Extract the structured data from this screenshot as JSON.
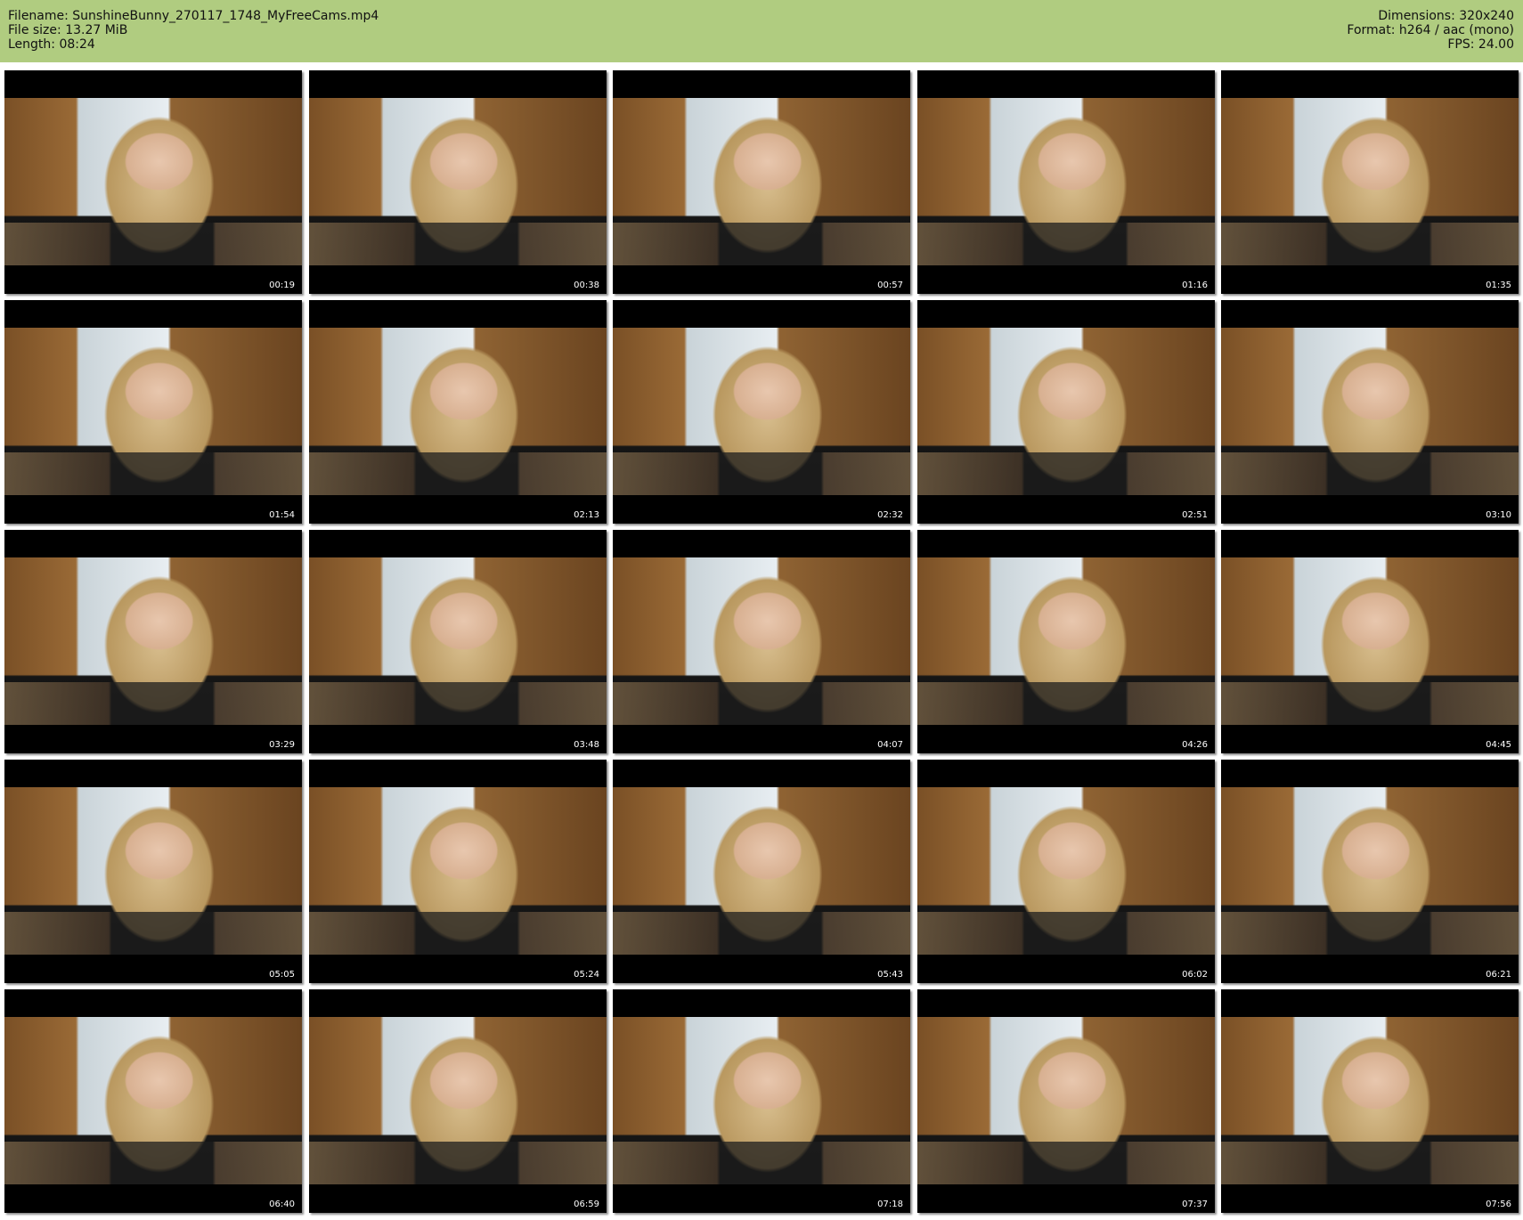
{
  "header": {
    "filename_line": "Filename: SunshineBunny_270117_1748_MyFreeCams.mp4",
    "filesize_line": "File size: 13.27 MiB",
    "length_line": "Length: 08:24",
    "dimensions_line": "Dimensions: 320x240",
    "format_line": "Format: h264 / aac (mono)",
    "fps_line": "FPS: 24.00"
  },
  "thumbnails": [
    {
      "time": "00:19"
    },
    {
      "time": "00:38"
    },
    {
      "time": "00:57"
    },
    {
      "time": "01:16"
    },
    {
      "time": "01:35"
    },
    {
      "time": "01:54"
    },
    {
      "time": "02:13"
    },
    {
      "time": "02:32"
    },
    {
      "time": "02:51"
    },
    {
      "time": "03:10"
    },
    {
      "time": "03:29"
    },
    {
      "time": "03:48"
    },
    {
      "time": "04:07"
    },
    {
      "time": "04:26"
    },
    {
      "time": "04:45"
    },
    {
      "time": "05:05"
    },
    {
      "time": "05:24"
    },
    {
      "time": "05:43"
    },
    {
      "time": "06:02"
    },
    {
      "time": "06:21"
    },
    {
      "time": "06:40"
    },
    {
      "time": "06:59"
    },
    {
      "time": "07:18"
    },
    {
      "time": "07:37"
    },
    {
      "time": "07:56"
    }
  ],
  "colors": {
    "header_bg": "#b0cc80",
    "tile_bg": "#000000",
    "timestamp_text": "#ffffff"
  }
}
